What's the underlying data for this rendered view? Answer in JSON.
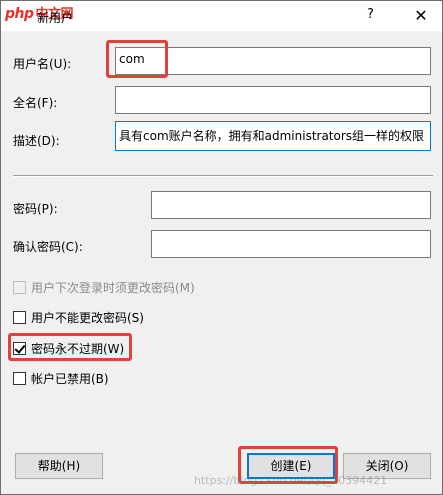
{
  "window": {
    "title": "新用户",
    "help_glyph": "?",
    "close_glyph": "✕"
  },
  "watermark": {
    "logo_php": "php",
    "logo_cn": "中文网",
    "url": "https://blog.csdn.net/qq_20394421"
  },
  "form": {
    "username_label": "用户名(U):",
    "username_value": "com",
    "fullname_label": "全名(F):",
    "fullname_value": "",
    "description_label": "描述(D):",
    "description_value": "具有com账户名称，拥有和administrators组一样的权限",
    "password_label": "密码(P):",
    "password_value": "",
    "confirm_label": "确认密码(C):",
    "confirm_value": ""
  },
  "options": {
    "must_change": {
      "label": "用户下次登录时须更改密码(M)",
      "checked": false,
      "enabled": false
    },
    "cannot_change": {
      "label": "用户不能更改密码(S)",
      "checked": false,
      "enabled": true
    },
    "never_expires": {
      "label": "密码永不过期(W)",
      "checked": true,
      "enabled": true
    },
    "disabled": {
      "label": "帐户已禁用(B)",
      "checked": false,
      "enabled": true
    }
  },
  "buttons": {
    "help": "帮助(H)",
    "create": "创建(E)",
    "close": "关闭(O)"
  },
  "colors": {
    "highlight": "#e0413a",
    "focus": "#0078d7",
    "logo": "#e8322a"
  }
}
